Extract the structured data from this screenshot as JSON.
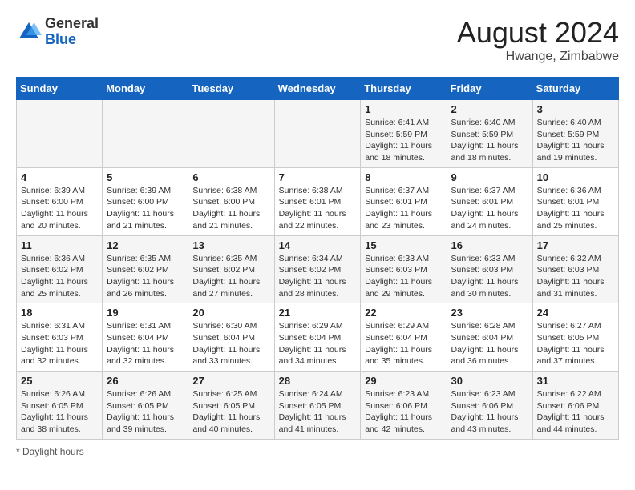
{
  "header": {
    "logo_general": "General",
    "logo_blue": "Blue",
    "month_year": "August 2024",
    "location": "Hwange, Zimbabwe"
  },
  "days_of_week": [
    "Sunday",
    "Monday",
    "Tuesday",
    "Wednesday",
    "Thursday",
    "Friday",
    "Saturday"
  ],
  "footer": {
    "daylight_label": "Daylight hours"
  },
  "weeks": [
    [
      {
        "num": "",
        "info": ""
      },
      {
        "num": "",
        "info": ""
      },
      {
        "num": "",
        "info": ""
      },
      {
        "num": "",
        "info": ""
      },
      {
        "num": "1",
        "info": "Sunrise: 6:41 AM\nSunset: 5:59 PM\nDaylight: 11 hours and 18 minutes."
      },
      {
        "num": "2",
        "info": "Sunrise: 6:40 AM\nSunset: 5:59 PM\nDaylight: 11 hours and 18 minutes."
      },
      {
        "num": "3",
        "info": "Sunrise: 6:40 AM\nSunset: 5:59 PM\nDaylight: 11 hours and 19 minutes."
      }
    ],
    [
      {
        "num": "4",
        "info": "Sunrise: 6:39 AM\nSunset: 6:00 PM\nDaylight: 11 hours and 20 minutes."
      },
      {
        "num": "5",
        "info": "Sunrise: 6:39 AM\nSunset: 6:00 PM\nDaylight: 11 hours and 21 minutes."
      },
      {
        "num": "6",
        "info": "Sunrise: 6:38 AM\nSunset: 6:00 PM\nDaylight: 11 hours and 21 minutes."
      },
      {
        "num": "7",
        "info": "Sunrise: 6:38 AM\nSunset: 6:01 PM\nDaylight: 11 hours and 22 minutes."
      },
      {
        "num": "8",
        "info": "Sunrise: 6:37 AM\nSunset: 6:01 PM\nDaylight: 11 hours and 23 minutes."
      },
      {
        "num": "9",
        "info": "Sunrise: 6:37 AM\nSunset: 6:01 PM\nDaylight: 11 hours and 24 minutes."
      },
      {
        "num": "10",
        "info": "Sunrise: 6:36 AM\nSunset: 6:01 PM\nDaylight: 11 hours and 25 minutes."
      }
    ],
    [
      {
        "num": "11",
        "info": "Sunrise: 6:36 AM\nSunset: 6:02 PM\nDaylight: 11 hours and 25 minutes."
      },
      {
        "num": "12",
        "info": "Sunrise: 6:35 AM\nSunset: 6:02 PM\nDaylight: 11 hours and 26 minutes."
      },
      {
        "num": "13",
        "info": "Sunrise: 6:35 AM\nSunset: 6:02 PM\nDaylight: 11 hours and 27 minutes."
      },
      {
        "num": "14",
        "info": "Sunrise: 6:34 AM\nSunset: 6:02 PM\nDaylight: 11 hours and 28 minutes."
      },
      {
        "num": "15",
        "info": "Sunrise: 6:33 AM\nSunset: 6:03 PM\nDaylight: 11 hours and 29 minutes."
      },
      {
        "num": "16",
        "info": "Sunrise: 6:33 AM\nSunset: 6:03 PM\nDaylight: 11 hours and 30 minutes."
      },
      {
        "num": "17",
        "info": "Sunrise: 6:32 AM\nSunset: 6:03 PM\nDaylight: 11 hours and 31 minutes."
      }
    ],
    [
      {
        "num": "18",
        "info": "Sunrise: 6:31 AM\nSunset: 6:03 PM\nDaylight: 11 hours and 32 minutes."
      },
      {
        "num": "19",
        "info": "Sunrise: 6:31 AM\nSunset: 6:04 PM\nDaylight: 11 hours and 32 minutes."
      },
      {
        "num": "20",
        "info": "Sunrise: 6:30 AM\nSunset: 6:04 PM\nDaylight: 11 hours and 33 minutes."
      },
      {
        "num": "21",
        "info": "Sunrise: 6:29 AM\nSunset: 6:04 PM\nDaylight: 11 hours and 34 minutes."
      },
      {
        "num": "22",
        "info": "Sunrise: 6:29 AM\nSunset: 6:04 PM\nDaylight: 11 hours and 35 minutes."
      },
      {
        "num": "23",
        "info": "Sunrise: 6:28 AM\nSunset: 6:04 PM\nDaylight: 11 hours and 36 minutes."
      },
      {
        "num": "24",
        "info": "Sunrise: 6:27 AM\nSunset: 6:05 PM\nDaylight: 11 hours and 37 minutes."
      }
    ],
    [
      {
        "num": "25",
        "info": "Sunrise: 6:26 AM\nSunset: 6:05 PM\nDaylight: 11 hours and 38 minutes."
      },
      {
        "num": "26",
        "info": "Sunrise: 6:26 AM\nSunset: 6:05 PM\nDaylight: 11 hours and 39 minutes."
      },
      {
        "num": "27",
        "info": "Sunrise: 6:25 AM\nSunset: 6:05 PM\nDaylight: 11 hours and 40 minutes."
      },
      {
        "num": "28",
        "info": "Sunrise: 6:24 AM\nSunset: 6:05 PM\nDaylight: 11 hours and 41 minutes."
      },
      {
        "num": "29",
        "info": "Sunrise: 6:23 AM\nSunset: 6:06 PM\nDaylight: 11 hours and 42 minutes."
      },
      {
        "num": "30",
        "info": "Sunrise: 6:23 AM\nSunset: 6:06 PM\nDaylight: 11 hours and 43 minutes."
      },
      {
        "num": "31",
        "info": "Sunrise: 6:22 AM\nSunset: 6:06 PM\nDaylight: 11 hours and 44 minutes."
      }
    ]
  ]
}
